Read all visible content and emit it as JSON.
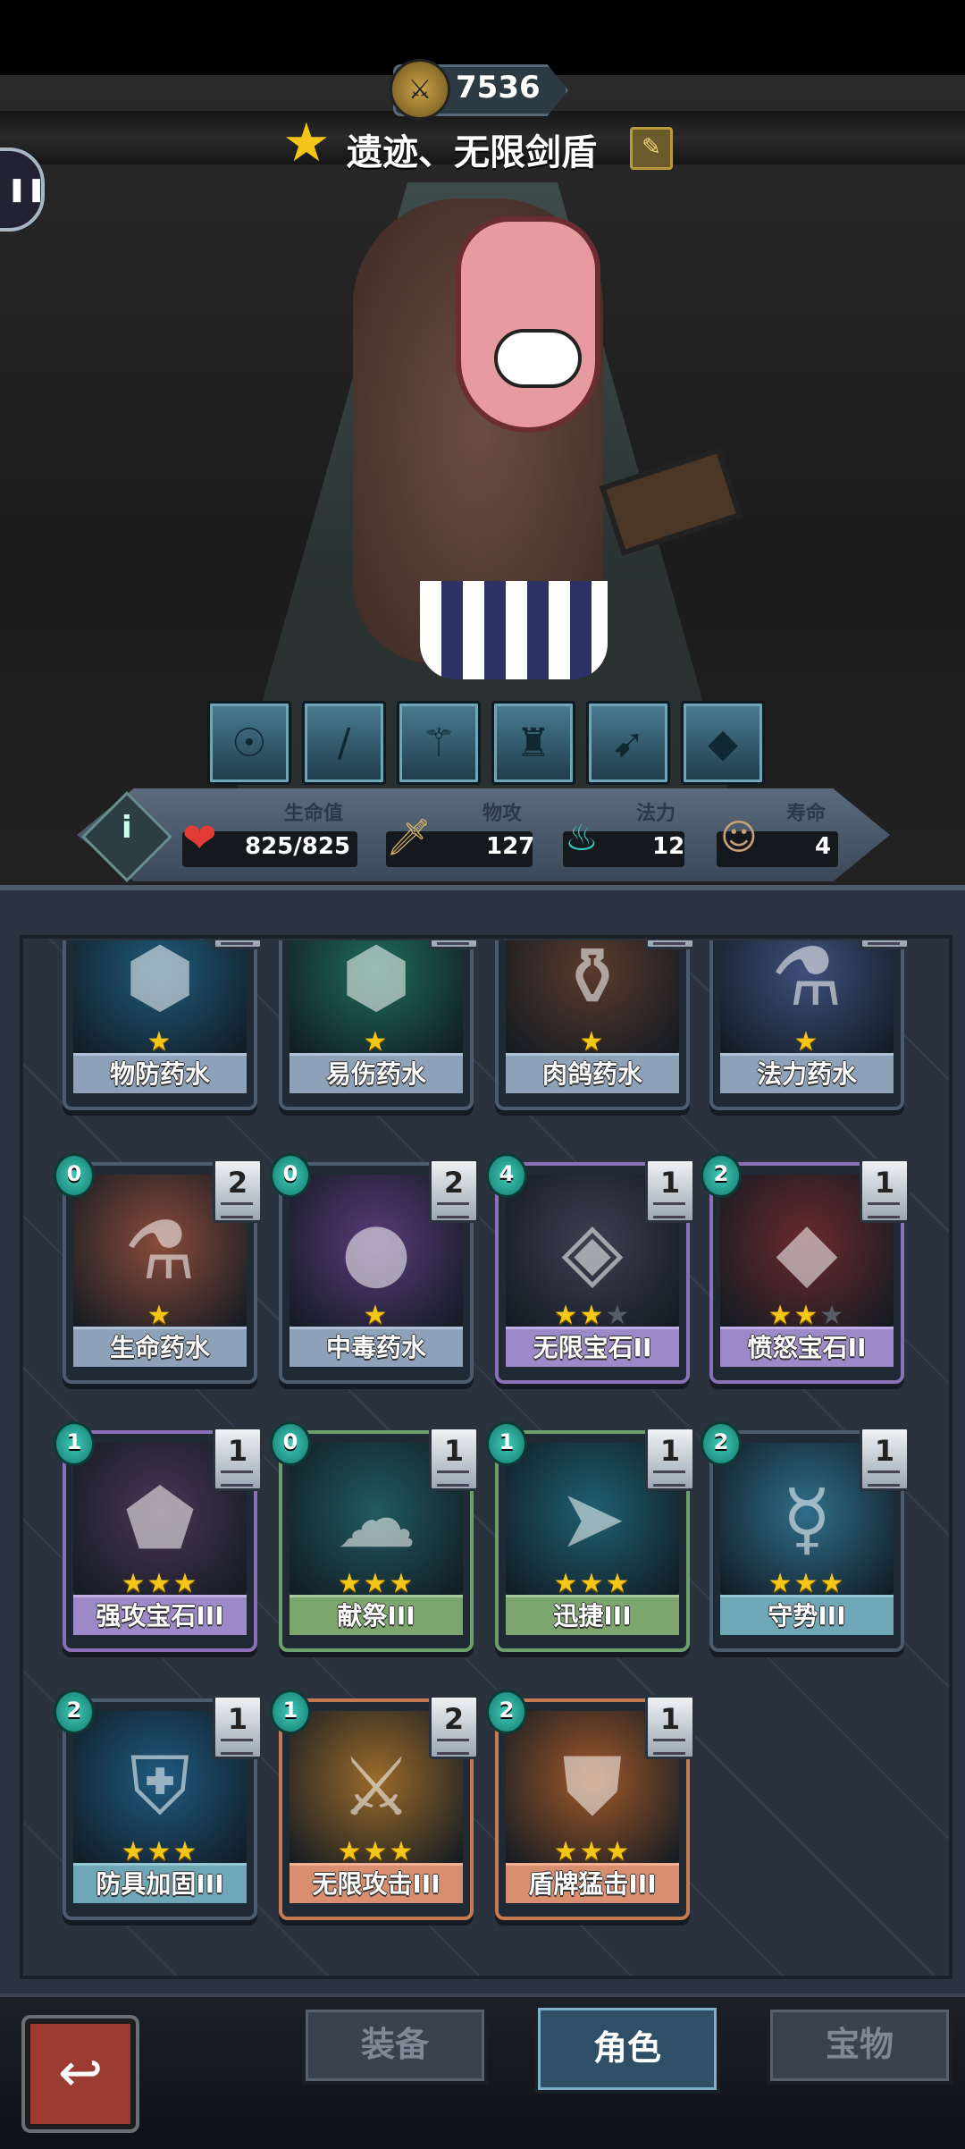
{
  "header": {
    "score": "7536",
    "hero_name": "遗迹、无限剑盾",
    "edit_icon": "edit-icon",
    "side_icon": "pause-icon"
  },
  "skill_icons": [
    "beast-skill-icon",
    "sword-skill-icon",
    "caduceus-skill-icon",
    "helmet-skill-icon",
    "bow-skill-icon",
    "blade-skill-icon"
  ],
  "stats": {
    "hp_label": "生命值",
    "hp_value": "825/825",
    "atk_label": "物攻",
    "atk_value": "127",
    "mana_label": "法力",
    "mana_value": "12",
    "life_label": "寿命",
    "life_value": "4"
  },
  "cards": [
    {
      "name": "物防药水",
      "stars": 1,
      "max_stars": 1,
      "color": "default",
      "art": "#1f5a7a"
    },
    {
      "name": "易伤药水",
      "stars": 1,
      "max_stars": 1,
      "color": "default",
      "art": "#1f6b5a"
    },
    {
      "name": "肉鸽药水",
      "stars": 1,
      "max_stars": 1,
      "color": "default",
      "art": "#5a3a2c"
    },
    {
      "name": "法力药水",
      "stars": 1,
      "max_stars": 1,
      "color": "default",
      "art": "#3f4f7a"
    },
    {
      "name": "生命药水",
      "cost": "0",
      "count": "2",
      "stars": 1,
      "max_stars": 1,
      "color": "default",
      "art": "#8a4b3a"
    },
    {
      "name": "中毒药水",
      "cost": "0",
      "count": "2",
      "stars": 1,
      "max_stars": 1,
      "color": "default",
      "art": "#5a3b78"
    },
    {
      "name": "无限宝石II",
      "cost": "4",
      "count": "1",
      "stars": 2,
      "max_stars": 3,
      "color": "purple",
      "art": "#3c4050"
    },
    {
      "name": "愤怒宝石II",
      "cost": "2",
      "count": "1",
      "stars": 2,
      "max_stars": 3,
      "color": "purple",
      "art": "#6a2a2c"
    },
    {
      "name": "强攻宝石III",
      "cost": "1",
      "count": "1",
      "stars": 3,
      "max_stars": 3,
      "color": "purple",
      "art": "#4a3654"
    },
    {
      "name": "献祭III",
      "cost": "0",
      "count": "1",
      "stars": 3,
      "max_stars": 3,
      "color": "green",
      "art": "#205a5e"
    },
    {
      "name": "迅捷III",
      "cost": "1",
      "count": "1",
      "stars": 3,
      "max_stars": 3,
      "color": "green",
      "art": "#1e6070"
    },
    {
      "name": "守势III",
      "cost": "2",
      "count": "1",
      "stars": 3,
      "max_stars": 3,
      "color": "teal",
      "art": "#2f6e8a"
    },
    {
      "name": "防具加固III",
      "cost": "2",
      "count": "1",
      "stars": 3,
      "max_stars": 3,
      "color": "teal",
      "art": "#1f5a80"
    },
    {
      "name": "无限攻击III",
      "cost": "1",
      "count": "2",
      "stars": 3,
      "max_stars": 3,
      "color": "orange",
      "art": "#9a6a2a"
    },
    {
      "name": "盾牌猛击III",
      "cost": "2",
      "count": "1",
      "stars": 3,
      "max_stars": 3,
      "color": "orange",
      "art": "#a0582a"
    }
  ],
  "tabs": {
    "equipment": "装备",
    "character": "角色",
    "treasure": "宝物"
  },
  "active_tab": "character"
}
